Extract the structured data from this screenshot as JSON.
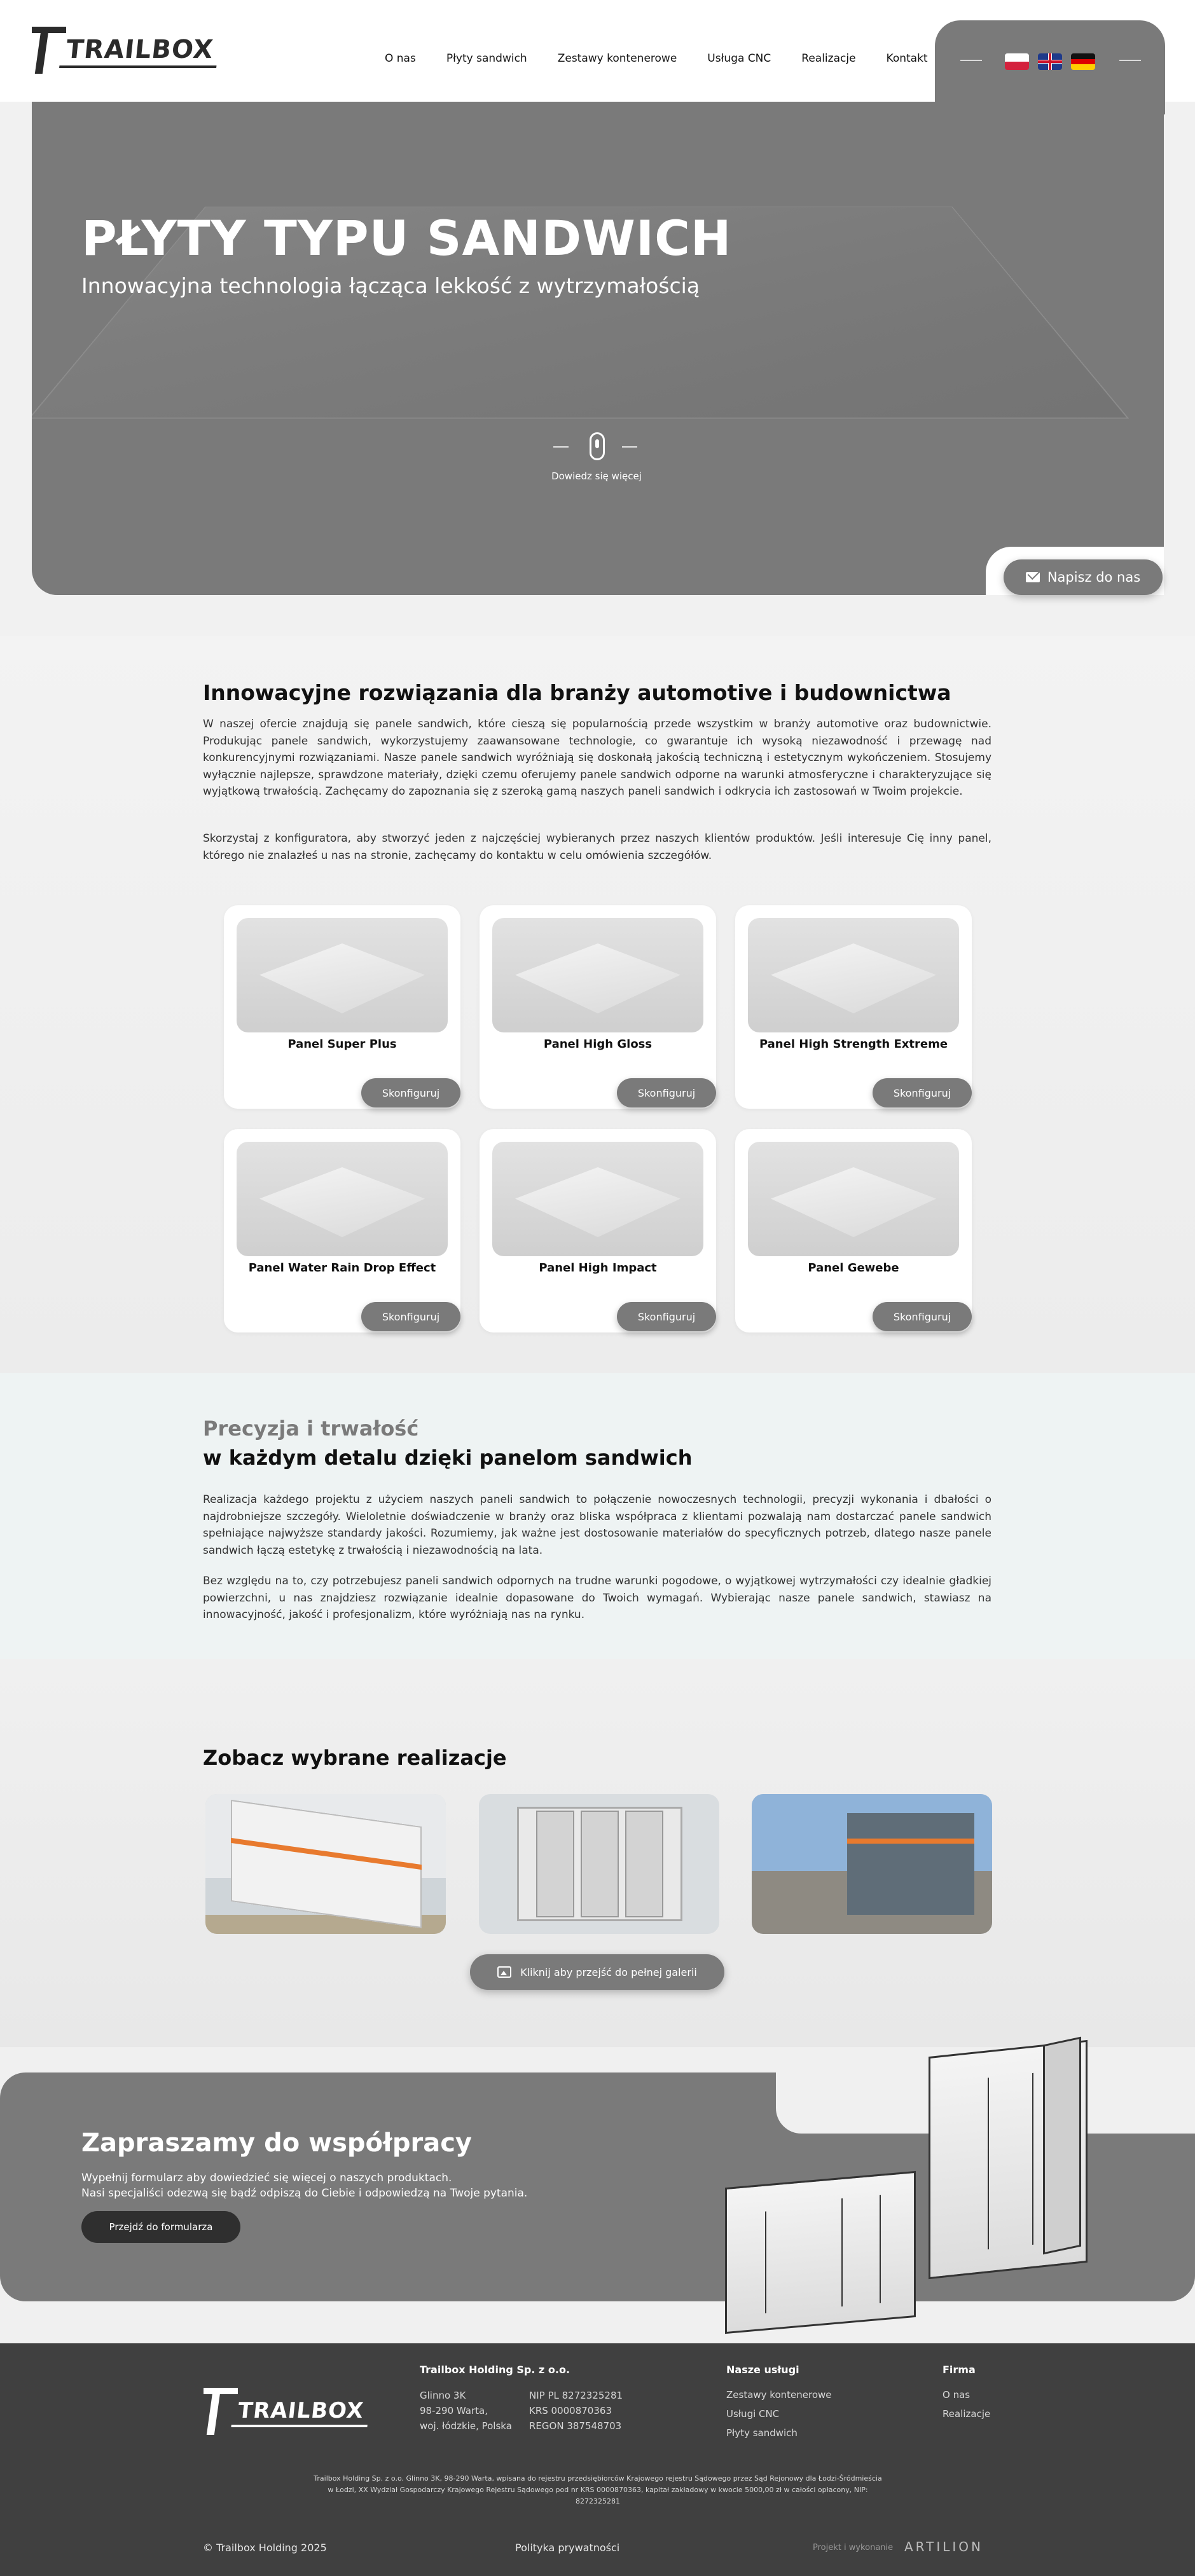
{
  "brand": {
    "logo_text": "TRAILBOX"
  },
  "nav": {
    "items": [
      {
        "label": "O nas"
      },
      {
        "label": "Płyty sandwich"
      },
      {
        "label": "Zestawy kontenerowe"
      },
      {
        "label": "Usługa CNC"
      },
      {
        "label": "Realizacje"
      },
      {
        "label": "Kontakt"
      }
    ]
  },
  "languages": [
    {
      "code": "pl",
      "icon": "flag-pl-icon"
    },
    {
      "code": "en",
      "icon": "flag-gb-icon"
    },
    {
      "code": "de",
      "icon": "flag-de-icon"
    }
  ],
  "hero": {
    "title": "PŁYTY TYPU SANDWICH",
    "subtitle": "Innowacyjna technologia łącząca lekkość z wytrzymałością",
    "scroll_label": "Dowiedz się więcej",
    "contact_button": "Napisz do nas"
  },
  "intro": {
    "title": "Innowacyjne rozwiązania dla branży automotive i budownictwa",
    "paragraph_1": "W naszej ofercie znajdują się panele sandwich, które cieszą się popularnością przede wszystkim w branży automotive oraz budownictwie. Produkując panele sandwich, wykorzystujemy zaawansowane technologie, co gwarantuje ich wysoką niezawodność i przewagę nad konkurencyjnymi rozwiązaniami. Nasze panele sandwich wyróżniają się doskonałą jakością techniczną i estetycznym wykończeniem. Stosujemy wyłącznie najlepsze, sprawdzone materiały, dzięki czemu oferujemy panele sandwich odporne na warunki atmosferyczne i charakteryzujące się wyjątkową trwałością. Zachęcamy do zapoznania się z szeroką gamą naszych paneli sandwich i odkrycia ich zastosowań w Twoim projekcie.",
    "paragraph_2": "Skorzystaj z konfiguratora, aby stworzyć jeden z najczęściej wybieranych przez naszych klientów produktów. Jeśli interesuje Cię inny panel, którego nie znalazłeś u nas na stronie, zachęcamy do kontaktu w celu omówienia szczegółów."
  },
  "products": [
    {
      "name": "Panel Super Plus",
      "button": "Skonfiguruj"
    },
    {
      "name": "Panel High Gloss",
      "button": "Skonfiguruj"
    },
    {
      "name": "Panel High Strength Extreme",
      "button": "Skonfiguruj"
    },
    {
      "name": "Panel Water Rain Drop Effect",
      "button": "Skonfiguruj"
    },
    {
      "name": "Panel High Impact",
      "button": "Skonfiguruj"
    },
    {
      "name": "Panel Gewebe",
      "button": "Skonfiguruj"
    }
  ],
  "precision": {
    "kicker": "Precyzja i trwałość",
    "title": "w każdym detalu dzięki panelom sandwich",
    "paragraph_1": "Realizacja każdego projektu z użyciem naszych paneli sandwich to połączenie nowoczesnych technologii, precyzji wykonania i dbałości o najdrobniejsze szczegóły. Wieloletnie doświadczenie w branży oraz bliska współpraca z klientami pozwalają nam dostarczać panele sandwich spełniające najwyższe standardy jakości. Rozumiemy, jak ważne jest dostosowanie materiałów do specyficznych potrzeb, dlatego nasze panele sandwich łączą estetykę z trwałością i niezawodnością na lata.",
    "paragraph_2": "Bez względu na to, czy potrzebujesz paneli sandwich odpornych na trudne warunki pogodowe, o wyjątkowej wytrzymałości czy idealnie gładkiej powierzchni, u nas znajdziesz rozwiązanie idealnie dopasowane do Twoich wymagań. Wybierając nasze panele sandwich, stawiasz na innowacyjność, jakość i profesjonalizm, które wyróżniają nas na rynku."
  },
  "realizations": {
    "title": "Zobacz wybrane realizacje",
    "gallery_button": "Kliknij aby przejść do pełnej galerii"
  },
  "cta": {
    "title": "Zapraszamy do współpracy",
    "text_1": "Wypełnij formularz aby dowiedzieć się więcej o naszych produktach.",
    "text_2": "Nasi specjaliści odezwą się bądź odpiszą do Ciebie i odpowiedzą na Twoje pytania.",
    "button": "Przejdź do formularza"
  },
  "footer": {
    "company_name": "Trailbox Holding Sp. z o.o.",
    "address_1": "Glinno 3K",
    "address_2": "98-290 Warta,",
    "address_3": "woj. łódzkie, Polska",
    "nip": "NIP PL 8272325281",
    "krs": "KRS 0000870363",
    "regon": "REGON 387548703",
    "services_title": "Nasze usługi",
    "services": [
      "Zestawy kontenerowe",
      "Usługi CNC",
      "Płyty sandwich"
    ],
    "company_title": "Firma",
    "company_links": [
      "O nas",
      "Realizacje"
    ],
    "legal_1": "Trailbox Holding Sp. z o.o. Glinno 3K, 98-290 Warta, wpisana do rejestru przedsiębiorców Krajowego rejestru Sądowego przez Sąd Rejonowy dla Łodzi-Śródmieścia",
    "legal_2": "w Łodzi, XX Wydział Gospodarczy Krajowego Rejestru Sądowego pod nr KRS 0000870363, kapitał zakładowy w kwocie 5000,00 zł w całości opłacony, NIP:",
    "legal_3": "8272325281",
    "copyright": "© Trailbox Holding 2025",
    "privacy": "Polityka prywatności",
    "author_label": "Projekt i wykonanie",
    "author_name": "ARTILION"
  }
}
